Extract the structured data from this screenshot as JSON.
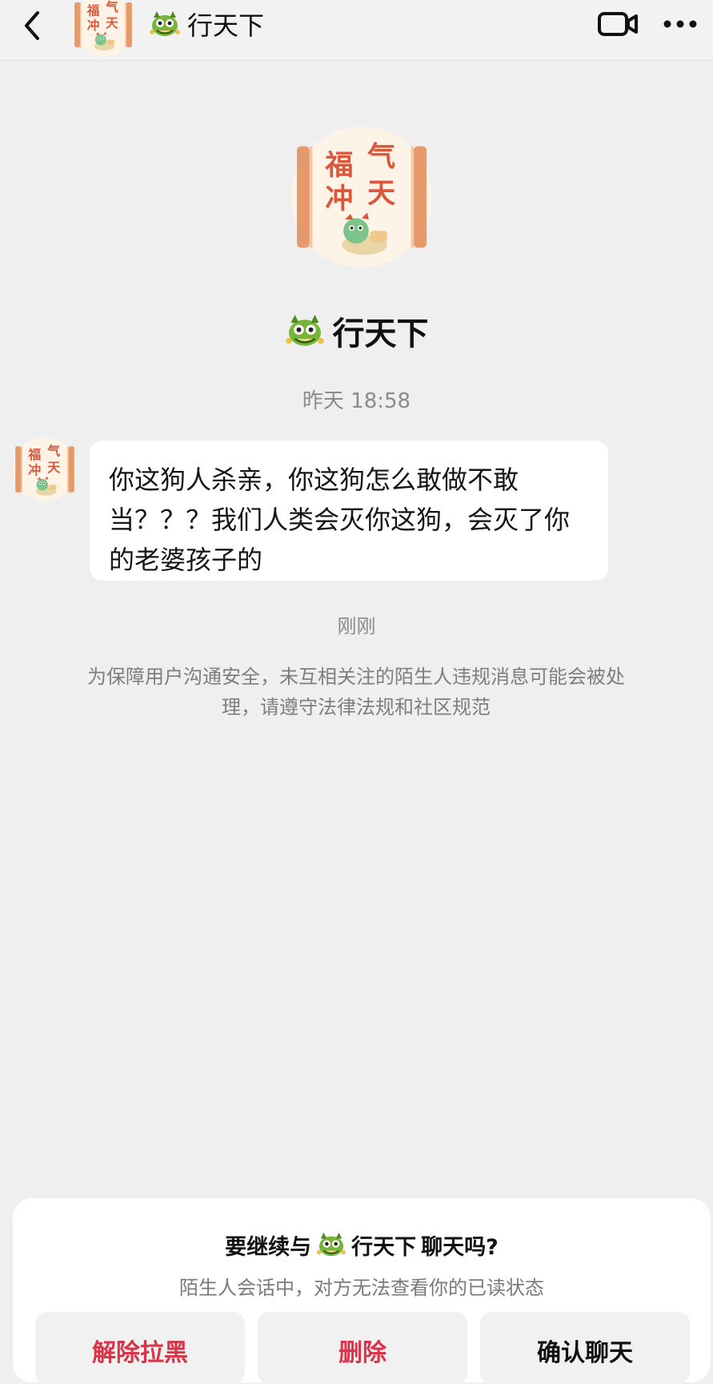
{
  "header": {
    "back_icon": "chevron-left-icon",
    "contact_name": "行天下",
    "name_prefix_icon": "dragon-emoji-icon",
    "video_icon": "video-camera-icon",
    "more_icon": "more-dots-icon"
  },
  "avatar": {
    "text_line1": "福气",
    "text_line2": "冲天",
    "accent_color": "#d9573a",
    "frame_color": "#e69a6c"
  },
  "profile": {
    "name": "行天下"
  },
  "conversation": {
    "timestamp": "昨天 18:58",
    "messages": [
      {
        "sender": "行天下",
        "text": "你这狗人杀亲，你这狗怎么敢做不敢当？？？我们人类会灭你这狗，会灭了你的老婆孩子的"
      }
    ],
    "recent_label": "刚刚",
    "notice": "为保障用户沟通安全，未互相关注的陌生人违规消息可能会被处理，请遵守法律法规和社区规范"
  },
  "sheet": {
    "title_prefix": "要继续与",
    "title_name": "行天下",
    "title_suffix": "聊天吗?",
    "subtitle": "陌生人会话中，对方无法查看你的已读状态",
    "buttons": {
      "unblock": "解除拉黑",
      "delete": "删除",
      "confirm": "确认聊天"
    },
    "danger_color": "#d8344a"
  }
}
